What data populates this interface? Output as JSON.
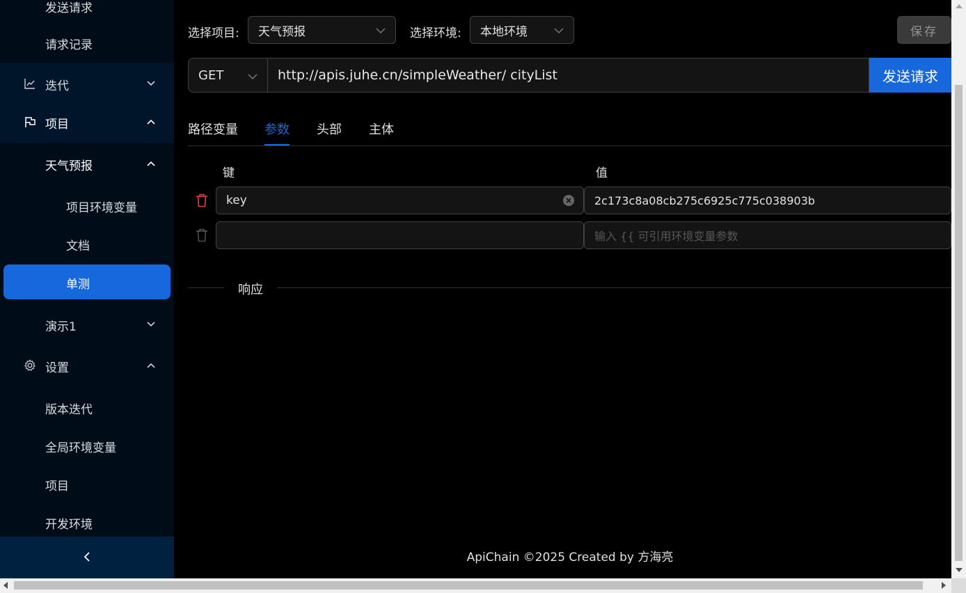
{
  "sidebar": {
    "items": [
      {
        "label": "发送请求"
      },
      {
        "label": "请求记录"
      },
      {
        "label": "迭代"
      },
      {
        "label": "项目"
      },
      {
        "label": "天气预报"
      },
      {
        "label": "项目环境变量"
      },
      {
        "label": "文档"
      },
      {
        "label": "单测"
      },
      {
        "label": "演示1"
      },
      {
        "label": "设置"
      },
      {
        "label": "版本迭代"
      },
      {
        "label": "全局环境变量"
      },
      {
        "label": "项目"
      },
      {
        "label": "开发环境"
      }
    ],
    "collapse_label": "<"
  },
  "toolbar": {
    "project_label": "选择项目:",
    "project_value": "天气预报",
    "env_label": "选择环境:",
    "env_value": "本地环境",
    "save_label": "保存"
  },
  "request": {
    "method": "GET",
    "url": "http://apis.juhe.cn/simpleWeather/ cityList",
    "send_label": "发送请求"
  },
  "tabs": [
    {
      "label": "路径变量",
      "active": false
    },
    {
      "label": "参数",
      "active": true
    },
    {
      "label": "头部",
      "active": false
    },
    {
      "label": "主体",
      "active": false
    }
  ],
  "params": {
    "key_header": "键",
    "value_header": "值",
    "rows": [
      {
        "key": "key",
        "value": "2c173c8a08cb275c6925c775c038903b"
      },
      {
        "key": "",
        "value": "",
        "value_placeholder": "输入 {{ 可引用环境变量参数"
      }
    ]
  },
  "response": {
    "title": "响应"
  },
  "footer": {
    "text": "ApiChain ©2025 Created by 方海亮"
  },
  "colors": {
    "accent": "#1668dc",
    "sidebar_bg": "#001529",
    "submenu_bg": "#000c17",
    "danger": "#dc4446"
  }
}
